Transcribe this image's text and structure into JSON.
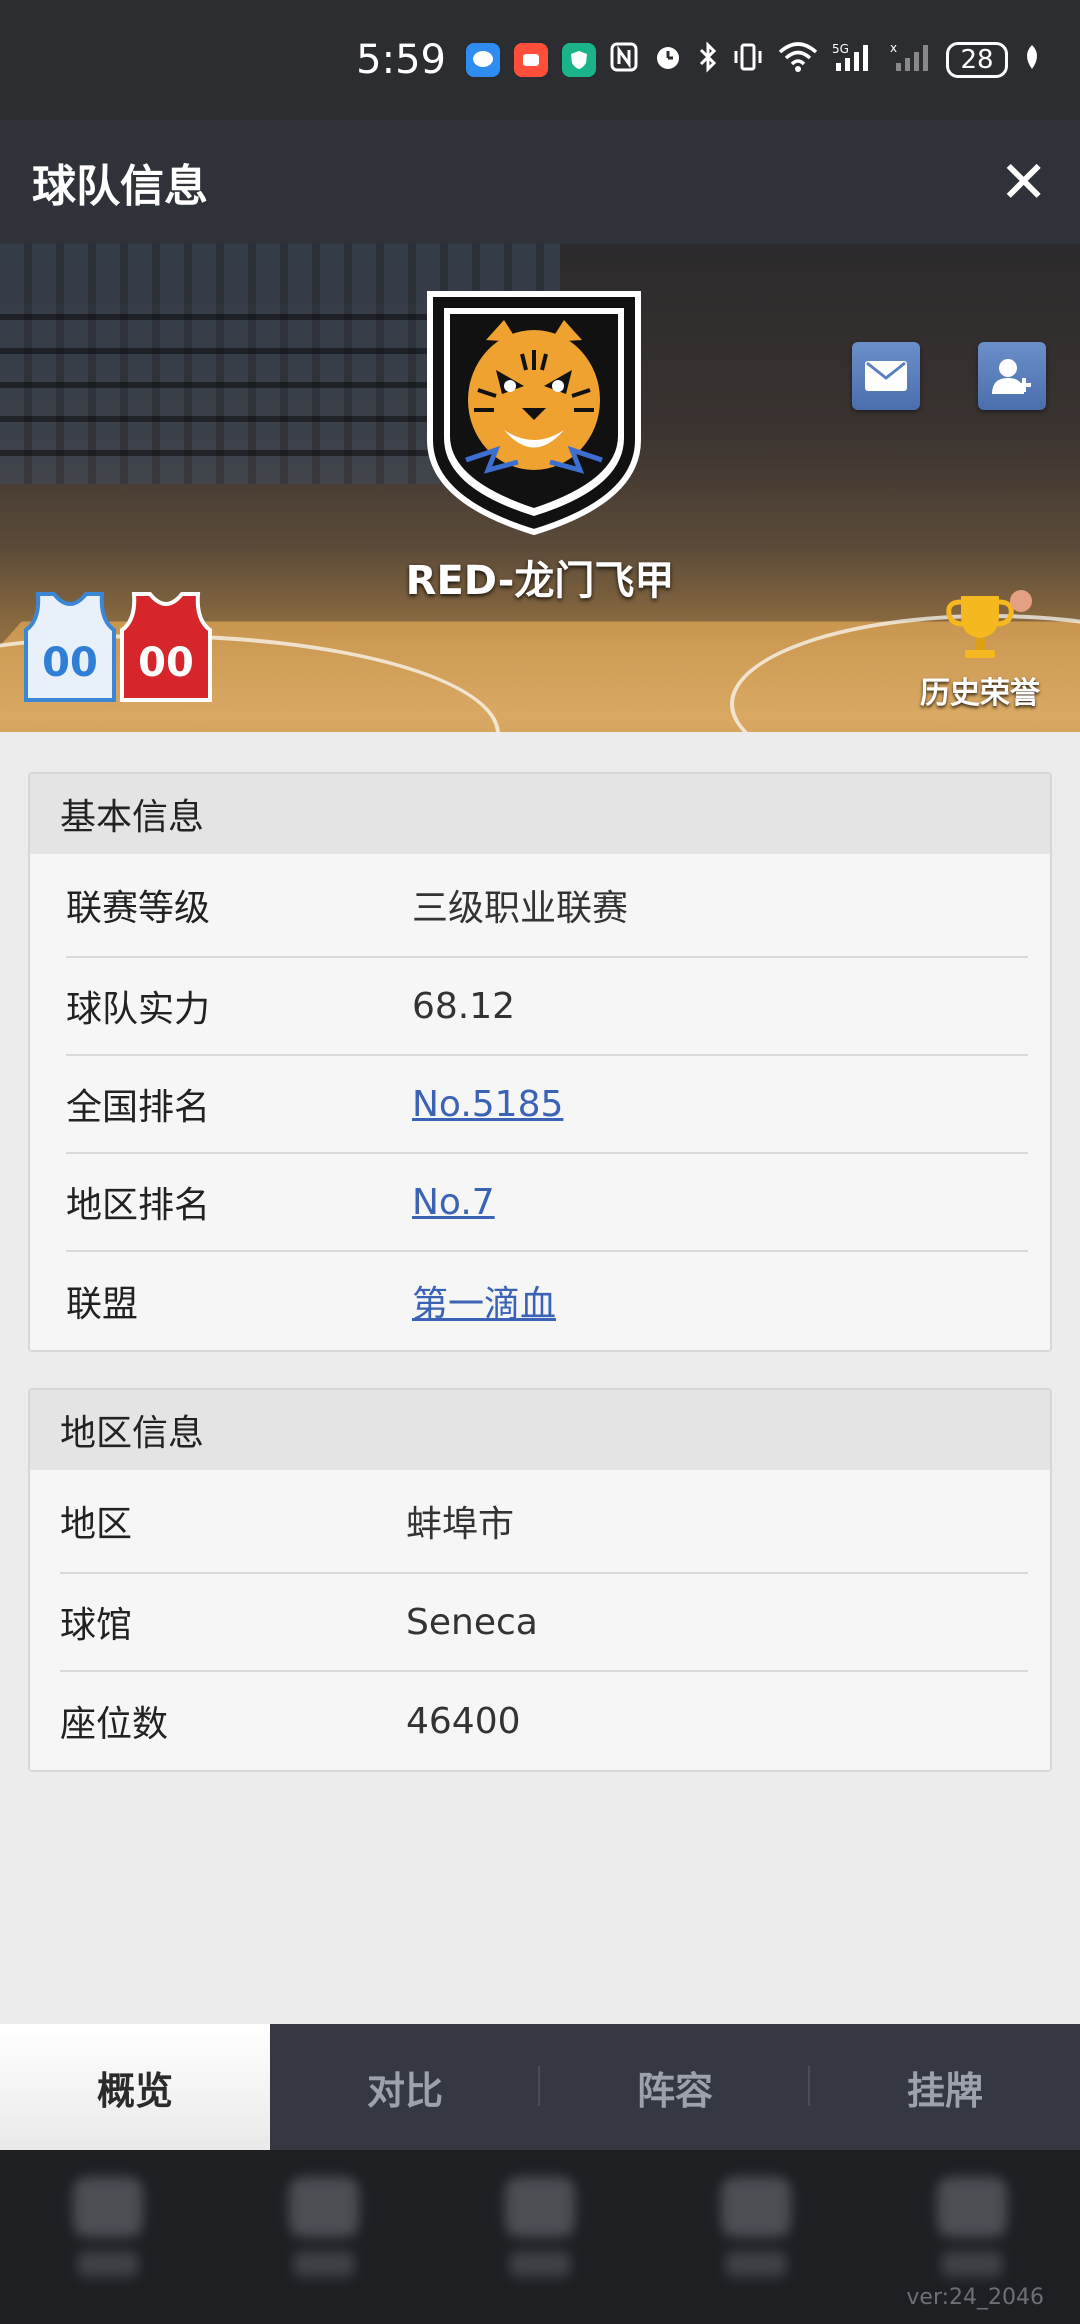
{
  "status_bar": {
    "time": "5:59",
    "battery": "28",
    "icons": [
      "message-app-icon",
      "taobao-app-icon",
      "shield-app-icon",
      "nfc-icon",
      "alarm-icon",
      "bluetooth-icon",
      "vibrate-icon",
      "wifi-icon",
      "signal-5g-icon",
      "signal-icon",
      "battery-icon",
      "leaf-icon"
    ]
  },
  "header": {
    "title": "球队信息",
    "close_glyph": "✕"
  },
  "team": {
    "name": "RED-龙门飞甲",
    "home_jersey_number": "00",
    "away_jersey_number": "00",
    "honors_label": "历史荣誉"
  },
  "basic_info": {
    "heading": "基本信息",
    "rows": [
      {
        "label": "联赛等级",
        "value": "三级职业联赛"
      },
      {
        "label": "球队实力",
        "value": "68.12"
      },
      {
        "label": "全国排名",
        "value": "No.5185"
      },
      {
        "label": "地区排名",
        "value": "No.7"
      },
      {
        "label": "联盟",
        "value": "第一滴血"
      }
    ]
  },
  "region_info": {
    "heading": "地区信息",
    "rows": [
      {
        "label": "地区",
        "value": "蚌埠市"
      },
      {
        "label": "球馆",
        "value": "Seneca"
      },
      {
        "label": "座位数",
        "value": "46400"
      }
    ]
  },
  "tabs": [
    {
      "label": "概览",
      "active": true
    },
    {
      "label": "对比",
      "active": false
    },
    {
      "label": "阵容",
      "active": false
    },
    {
      "label": "挂牌",
      "active": false
    }
  ],
  "version": "ver:24_2046",
  "colors": {
    "header_bg": "#2f3238",
    "link": "#3a63b5",
    "tab_bar_bg": "#353841",
    "icon_button": "#5a7fbf"
  }
}
